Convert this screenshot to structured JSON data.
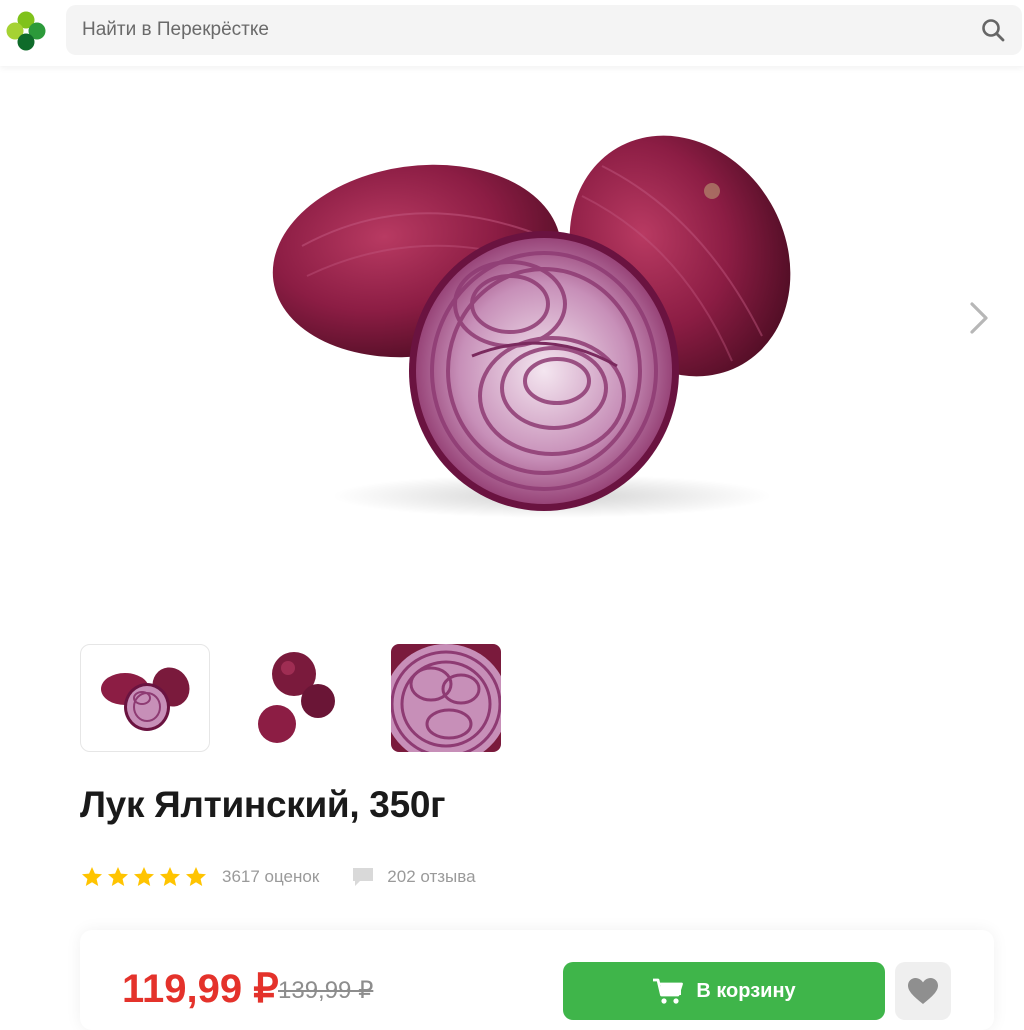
{
  "header": {
    "search_placeholder": "Найти в Перекрёстке"
  },
  "product": {
    "title": "Лук Ялтинский, 350г",
    "rating_stars": 5,
    "ratings_count": "3617 оценок",
    "reviews_count": "202 отзыва",
    "price": "119,99 ₽",
    "old_price": "139,99 ₽",
    "cart_button": "В корзину"
  },
  "colors": {
    "brand_green": "#3fb54a",
    "price_red": "#e4322b",
    "star_yellow": "#ffc400"
  },
  "icons": {
    "logo": "perekrestok-clover-logo",
    "search": "search-icon",
    "next": "chevron-right-icon",
    "star": "star-icon",
    "reviews": "comment-icon",
    "cart": "cart-icon",
    "favorite": "heart-icon"
  },
  "gallery": {
    "thumbnails": [
      {
        "name": "three red onions, one cut",
        "active": true
      },
      {
        "name": "three whole red onions",
        "active": false
      },
      {
        "name": "close-up of onion cross-section",
        "active": false
      }
    ]
  }
}
